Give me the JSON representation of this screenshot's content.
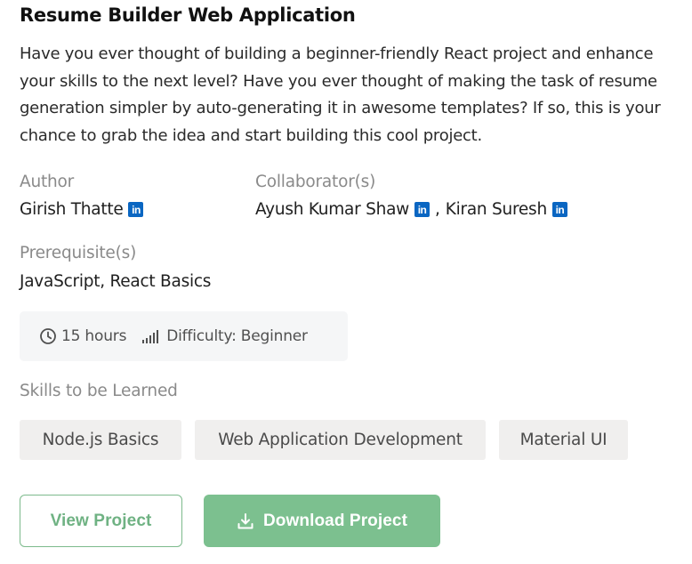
{
  "project": {
    "title": "Resume Builder Web Application",
    "description": "Have you ever thought of building a beginner-friendly React project and enhance your skills to the next level? Have you ever thought of making the task of resume generation simpler by auto-generating it in awesome templates? If so, this is your chance to grab the idea and start building this cool project."
  },
  "author": {
    "label": "Author",
    "name": "Girish Thatte",
    "icon": "linkedin-icon"
  },
  "collaborators": {
    "label": "Collaborator(s)",
    "people": [
      {
        "name": "Ayush Kumar Shaw",
        "icon": "linkedin-icon"
      },
      {
        "name": "Kiran Suresh",
        "icon": "linkedin-icon"
      }
    ],
    "separator": ","
  },
  "prerequisites": {
    "label": "Prerequisite(s)",
    "value": "JavaScript, React Basics"
  },
  "meta": {
    "duration": "15 hours",
    "duration_icon": "clock-icon",
    "difficulty": "Difficulty: Beginner",
    "difficulty_icon": "signal-bars-icon"
  },
  "skills": {
    "label": "Skills to be Learned",
    "items": [
      "Node.js Basics",
      "Web Application Development",
      "Material UI"
    ]
  },
  "actions": {
    "view_label": "View Project",
    "download_label": "Download Project",
    "download_icon": "download-icon"
  },
  "colors": {
    "linkedin": "#0a66c2",
    "accent_green": "#7cc08f",
    "outline_green": "#7cba8c",
    "muted_label": "#8a8a8a"
  }
}
